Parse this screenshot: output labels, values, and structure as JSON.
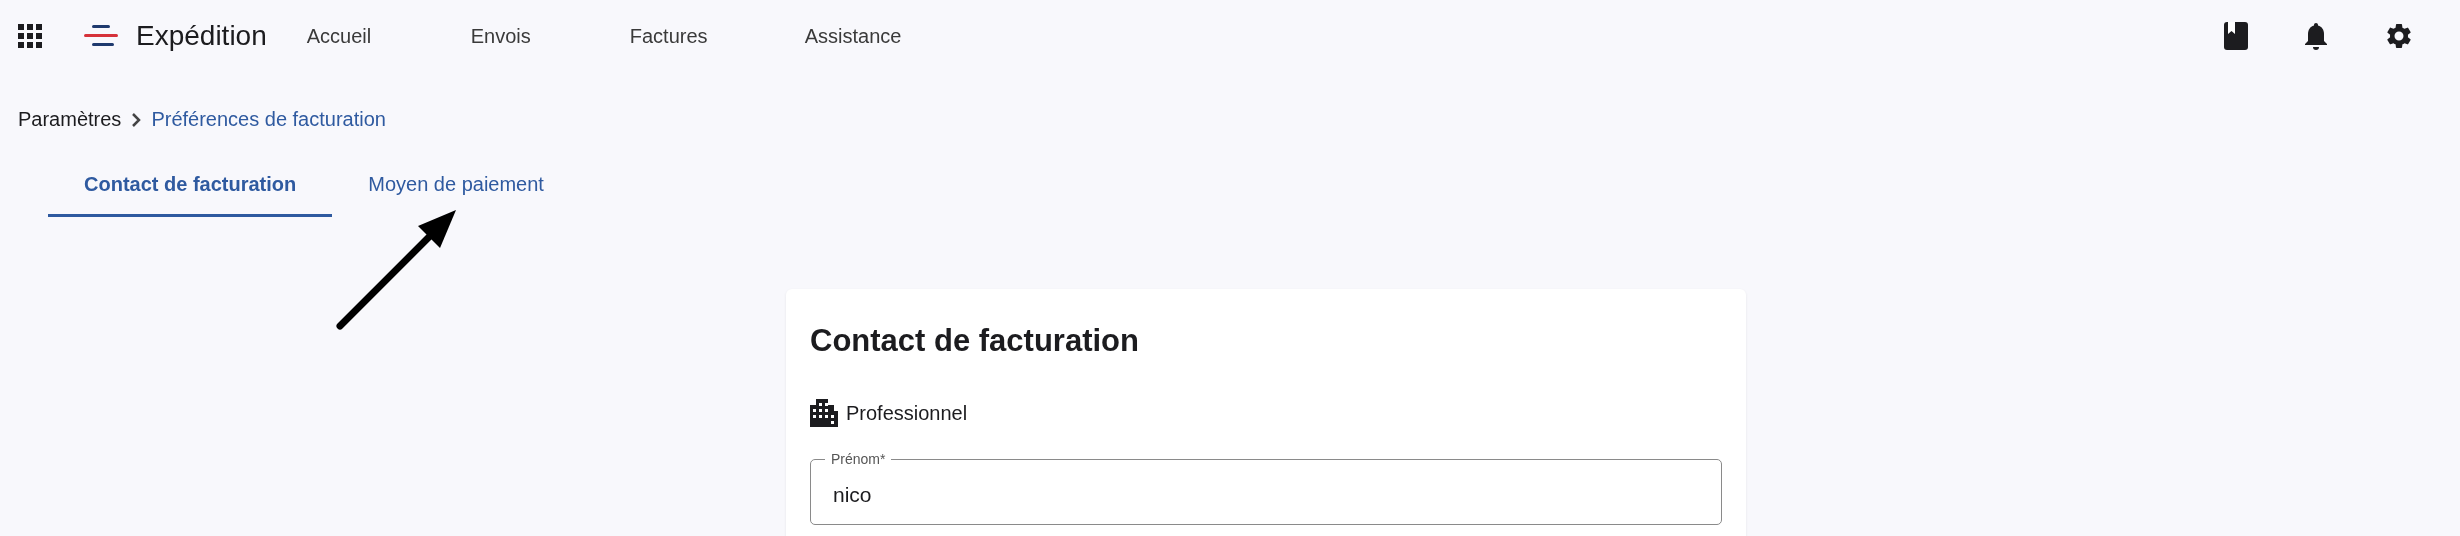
{
  "header": {
    "app_name": "Expédition",
    "nav": [
      {
        "label": "Accueil"
      },
      {
        "label": "Envois"
      },
      {
        "label": "Factures"
      },
      {
        "label": "Assistance"
      }
    ]
  },
  "breadcrumb": [
    "Paramètres",
    "Préférences de facturation"
  ],
  "tabs": [
    {
      "label": "Contact de facturation",
      "selected": true
    },
    {
      "label": "Moyen de paiement",
      "selected": false
    }
  ],
  "card": {
    "title": "Contact de facturation",
    "customer_type": "Professionnel",
    "fields": [
      {
        "label": "Prénom*",
        "value": "nico"
      }
    ]
  }
}
